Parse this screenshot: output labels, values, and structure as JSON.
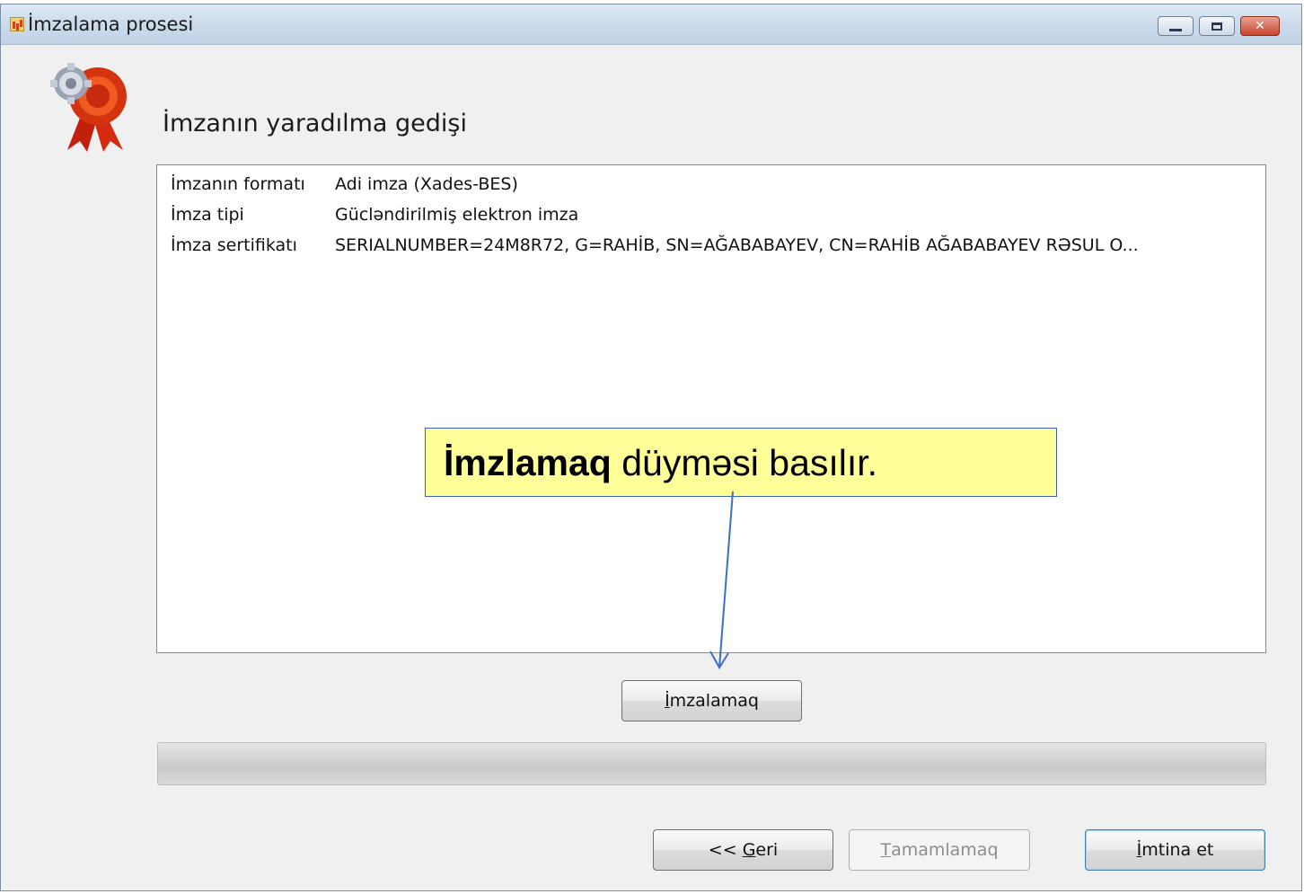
{
  "window": {
    "title": "İmzalama prosesi",
    "controls": {
      "minimize": "minimize-icon",
      "maximize": "maximize-icon",
      "close": "✕"
    }
  },
  "header": {
    "title": "İmzanın yaradılma gedişi",
    "logo_icon": "certificate-gear-ribbon-icon"
  },
  "details": [
    {
      "key": "İmzanın formatı",
      "value": "Adi imza (Xades-BES)"
    },
    {
      "key": "İmza tipi",
      "value": "Gücləndirilmiş elektron imza"
    },
    {
      "key": "İmza sertifikatı",
      "value": "SERIALNUMBER=24M8R72, G=RAHİB, SN=AĞABABAYEV, CN=RAHİB AĞABABAYEV RƏSUL O..."
    }
  ],
  "callout": {
    "bold": "İmzlamaq",
    "rest": " düyməsi basılır."
  },
  "buttons": {
    "sign": {
      "first": "İ",
      "rest": "mzalamaq"
    },
    "back": {
      "prefix": "<< ",
      "first": "G",
      "rest": "eri"
    },
    "finish": {
      "first": "T",
      "rest": "amamlamaq",
      "disabled": true
    },
    "cancel": {
      "first": "İ",
      "rest": "mtina et"
    }
  },
  "progress": {
    "value": 0
  },
  "colors": {
    "callout_bg": "#ffff99",
    "callout_border": "#3f5fbf",
    "arrow": "#3f6fbf"
  }
}
